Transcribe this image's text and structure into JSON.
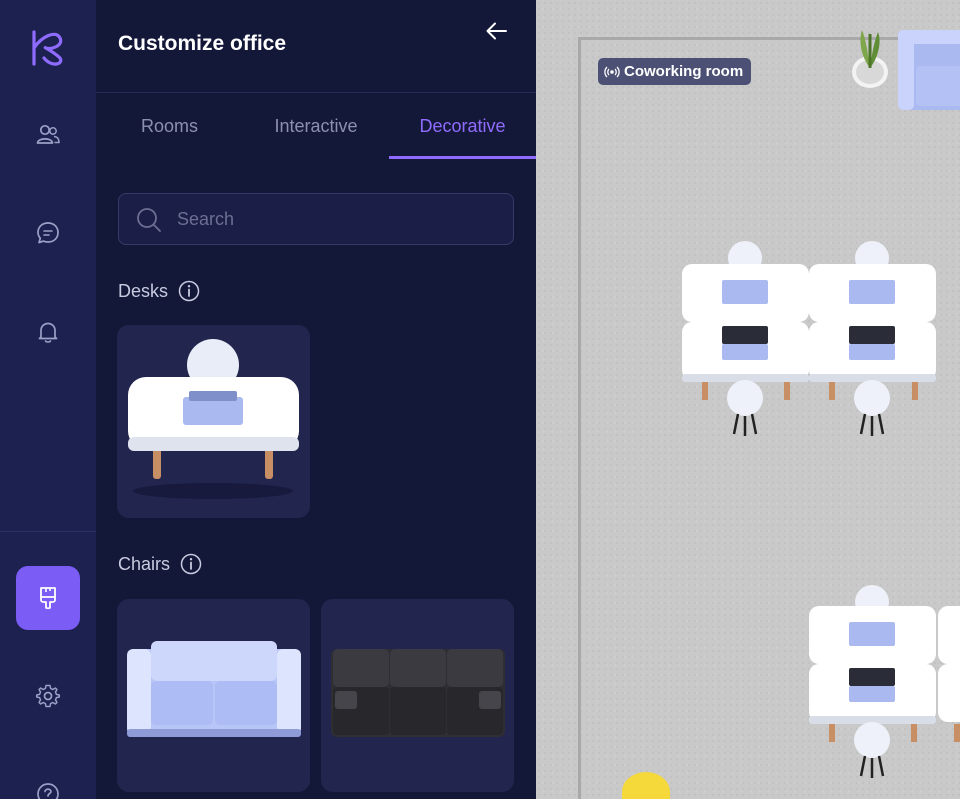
{
  "panel": {
    "title": "Customize office",
    "tabs": [
      {
        "label": "Rooms",
        "active": false
      },
      {
        "label": "Interactive",
        "active": false
      },
      {
        "label": "Decorative",
        "active": true
      }
    ],
    "search_placeholder": "Search",
    "sections": [
      {
        "label": "Desks"
      },
      {
        "label": "Chairs"
      }
    ]
  },
  "map": {
    "room_label": "Coworking room"
  },
  "colors": {
    "accent": "#7b5cf5",
    "tab_active": "#8f6cff",
    "rail_bg": "#1d2150",
    "panel_bg": "#141838",
    "card_bg": "#22264f"
  },
  "rail": {
    "icons": [
      "people-icon",
      "chat-icon",
      "bell-icon",
      "paint-brush-icon",
      "gear-icon",
      "help-icon"
    ]
  }
}
